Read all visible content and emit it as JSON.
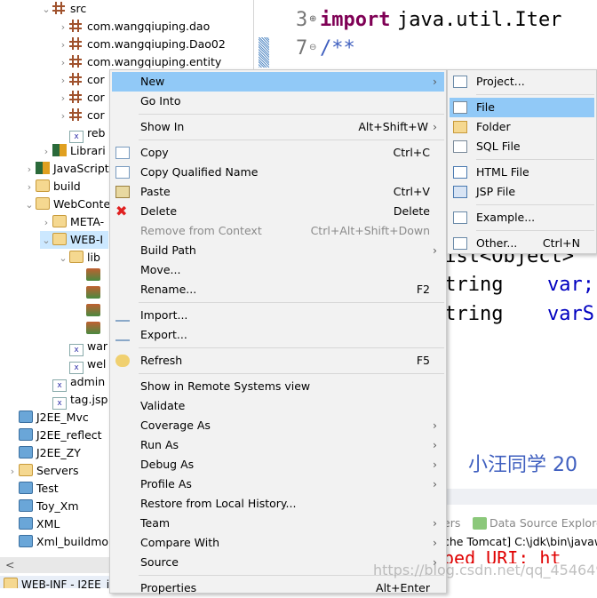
{
  "tree": {
    "items": [
      {
        "label": "src",
        "indent": 3,
        "tw": "v",
        "icon": "pkg"
      },
      {
        "label": "com.wangqiuping.dao",
        "indent": 4,
        "tw": ">",
        "icon": "pkg"
      },
      {
        "label": "com.wangqiuping.Dao02",
        "indent": 4,
        "tw": ">",
        "icon": "pkg"
      },
      {
        "label": "com.wangqiuping.entity",
        "indent": 4,
        "tw": ">",
        "icon": "pkg"
      },
      {
        "label": "cor",
        "indent": 4,
        "tw": ">",
        "icon": "pkg"
      },
      {
        "label": "cor",
        "indent": 4,
        "tw": ">",
        "icon": "pkg"
      },
      {
        "label": "cor",
        "indent": 4,
        "tw": ">",
        "icon": "pkg"
      },
      {
        "label": "reb",
        "indent": 4,
        "tw": "",
        "icon": "xml"
      },
      {
        "label": "Librari",
        "indent": 3,
        "tw": ">",
        "icon": "lib"
      },
      {
        "label": "JavaScript",
        "indent": 2,
        "tw": ">",
        "icon": "lib"
      },
      {
        "label": "build",
        "indent": 2,
        "tw": ">",
        "icon": "fold"
      },
      {
        "label": "WebConte",
        "indent": 2,
        "tw": "v",
        "icon": "fold"
      },
      {
        "label": "META-",
        "indent": 3,
        "tw": ">",
        "icon": "fold"
      },
      {
        "label": "WEB-I",
        "indent": 3,
        "tw": "v",
        "icon": "fold",
        "selected": true
      },
      {
        "label": "lib",
        "indent": 4,
        "tw": "v",
        "icon": "fold"
      },
      {
        "label": "",
        "indent": 5,
        "tw": "",
        "icon": "jar"
      },
      {
        "label": "",
        "indent": 5,
        "tw": "",
        "icon": "jar"
      },
      {
        "label": "",
        "indent": 5,
        "tw": "",
        "icon": "jar"
      },
      {
        "label": "",
        "indent": 5,
        "tw": "",
        "icon": "jar"
      },
      {
        "label": "war",
        "indent": 4,
        "tw": "",
        "icon": "xml"
      },
      {
        "label": "wel",
        "indent": 4,
        "tw": "",
        "icon": "xml"
      },
      {
        "label": "admin",
        "indent": 3,
        "tw": "",
        "icon": "xml"
      },
      {
        "label": "tag.jsp",
        "indent": 3,
        "tw": "",
        "icon": "xml"
      },
      {
        "label": "J2EE_Mvc",
        "indent": 1,
        "tw": "",
        "icon": "proj"
      },
      {
        "label": "J2EE_reflect",
        "indent": 1,
        "tw": "",
        "icon": "proj"
      },
      {
        "label": "J2EE_ZY",
        "indent": 1,
        "tw": "",
        "icon": "proj"
      },
      {
        "label": "Servers",
        "indent": 1,
        "tw": ">",
        "icon": "fold"
      },
      {
        "label": "Test",
        "indent": 1,
        "tw": "",
        "icon": "proj"
      },
      {
        "label": "Toy_Xm",
        "indent": 1,
        "tw": "",
        "icon": "proj"
      },
      {
        "label": "XML",
        "indent": 1,
        "tw": "",
        "icon": "proj"
      },
      {
        "label": "Xml_buildmo",
        "indent": 1,
        "tw": "",
        "icon": "proj"
      }
    ]
  },
  "status": {
    "text": "WEB-INF - J2EE_i"
  },
  "editor": {
    "line3": "3",
    "line3_kw": "import",
    "line3_rest": " java.util.Iter",
    "line7": "7",
    "line7_code": "/**",
    "code1": "List<Object>",
    "code2a": "String",
    "code2b": "var;",
    "code3a": "String",
    "code3b": "varS",
    "comment": "小汪同学 20"
  },
  "views": {
    "tab1": "ers",
    "tab2": "Data Source Explorer",
    "console": "che Tomcat] C:\\jdk\\bin\\javaw",
    "error": "ped  URI: ht",
    "watermark": "https://blog.csdn.net/qq_45464930"
  },
  "menu": {
    "items": [
      {
        "label": "New",
        "arrow": true,
        "hl": true
      },
      {
        "label": "Go Into"
      },
      {
        "sep": true
      },
      {
        "label": "Show In",
        "shortcut": "Alt+Shift+W",
        "arrow": true
      },
      {
        "sep": true
      },
      {
        "label": "Copy",
        "shortcut": "Ctrl+C",
        "icon": "copy"
      },
      {
        "label": "Copy Qualified Name",
        "icon": "copy"
      },
      {
        "label": "Paste",
        "shortcut": "Ctrl+V",
        "icon": "paste"
      },
      {
        "label": "Delete",
        "shortcut": "Delete",
        "icon": "delete"
      },
      {
        "label": "Remove from Context",
        "shortcut": "Ctrl+Alt+Shift+Down",
        "disabled": true,
        "icon": "remove"
      },
      {
        "label": "Build Path",
        "arrow": true
      },
      {
        "label": "Move..."
      },
      {
        "label": "Rename...",
        "shortcut": "F2"
      },
      {
        "sep": true
      },
      {
        "label": "Import...",
        "icon": "import"
      },
      {
        "label": "Export...",
        "icon": "export"
      },
      {
        "sep": true
      },
      {
        "label": "Refresh",
        "shortcut": "F5",
        "icon": "refresh"
      },
      {
        "sep": true
      },
      {
        "label": "Show in Remote Systems view"
      },
      {
        "label": "Validate"
      },
      {
        "label": "Coverage As",
        "arrow": true
      },
      {
        "label": "Run As",
        "arrow": true
      },
      {
        "label": "Debug As",
        "arrow": true
      },
      {
        "label": "Profile As",
        "arrow": true
      },
      {
        "label": "Restore from Local History..."
      },
      {
        "label": "Team",
        "arrow": true
      },
      {
        "label": "Compare With",
        "arrow": true
      },
      {
        "label": "Source",
        "arrow": true
      },
      {
        "sep": true
      },
      {
        "label": "Properties",
        "shortcut": "Alt+Enter"
      }
    ]
  },
  "submenu": {
    "items": [
      {
        "label": "Project...",
        "icon": "project"
      },
      {
        "sep": true
      },
      {
        "label": "File",
        "icon": "file",
        "hl": true
      },
      {
        "label": "Folder",
        "icon": "folder"
      },
      {
        "label": "SQL File",
        "icon": "sql"
      },
      {
        "sep": true
      },
      {
        "label": "HTML File",
        "icon": "html"
      },
      {
        "label": "JSP File",
        "icon": "jsp"
      },
      {
        "sep": true
      },
      {
        "label": "Example...",
        "icon": "example"
      },
      {
        "sep": true
      },
      {
        "label": "Other...",
        "shortcut": "Ctrl+N",
        "icon": "other"
      }
    ]
  },
  "colors": {
    "highlight": "#91c9f7",
    "selection": "#cce8ff",
    "keyword": "#7f0055",
    "comment": "#3f5fbf",
    "error": "#e00000"
  }
}
